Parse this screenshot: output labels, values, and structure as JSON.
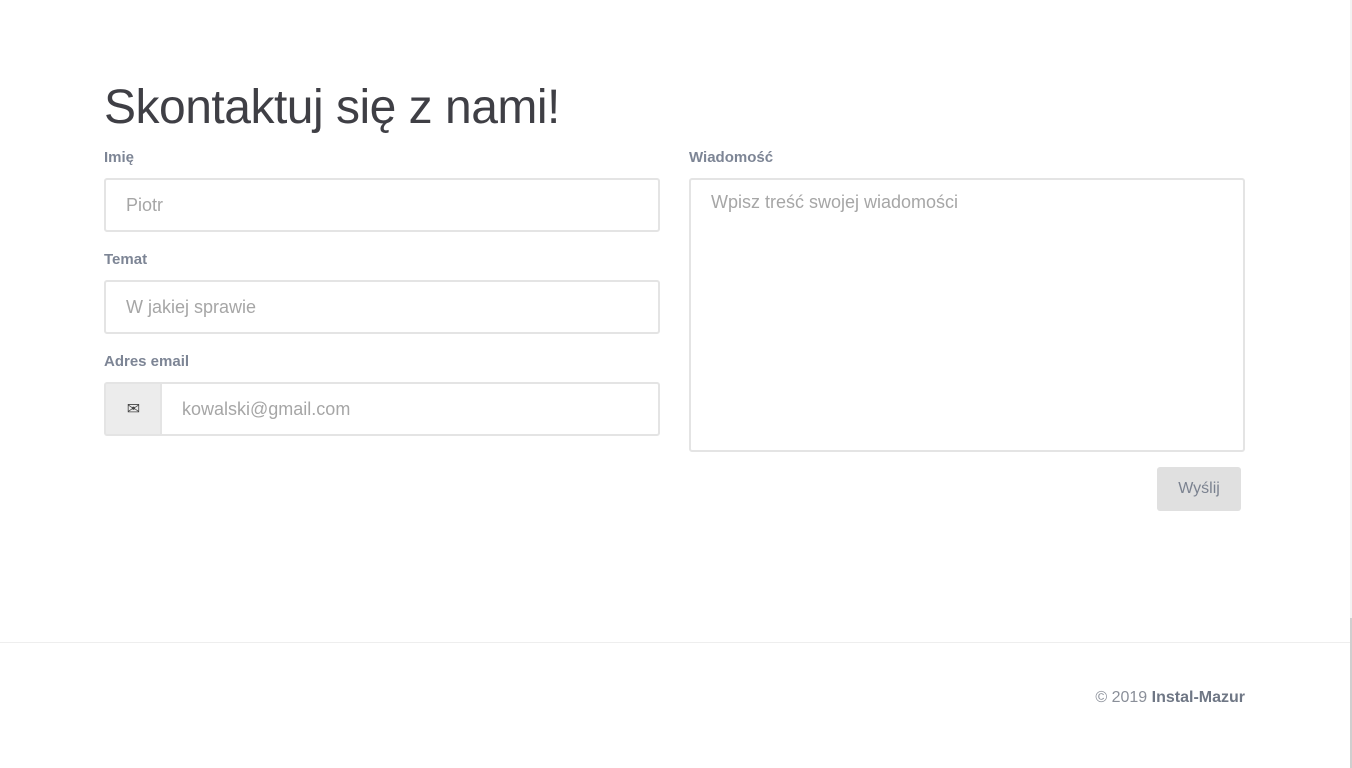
{
  "title": "Skontaktuj się z nami!",
  "form": {
    "name": {
      "label": "Imię",
      "placeholder": "Piotr",
      "value": ""
    },
    "subject": {
      "label": "Temat",
      "placeholder": "W jakiej sprawie",
      "value": ""
    },
    "email": {
      "label": "Adres email",
      "placeholder": "kowalski@gmail.com",
      "value": "",
      "icon": "envelope-icon"
    },
    "message": {
      "label": "Wiadomość",
      "placeholder": "Wpisz treść swojej wiadomości",
      "value": ""
    },
    "submit_label": "Wyślij"
  },
  "footer": {
    "copyright": "© 2019 ",
    "brand": "Instal-Mazur"
  },
  "colors": {
    "label": "#7d8595",
    "border": "#e4e4e4",
    "button_bg": "#e0e0e0"
  }
}
